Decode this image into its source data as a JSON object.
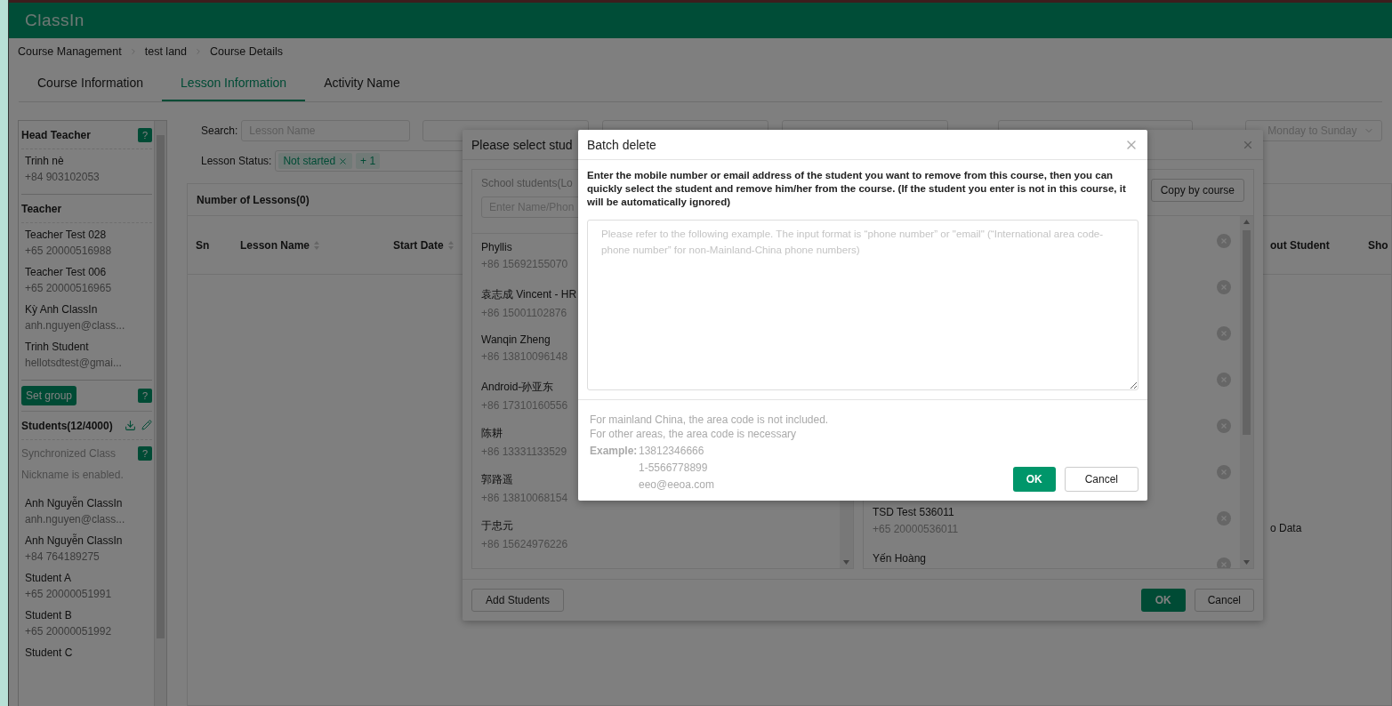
{
  "header": {
    "logo": "ClassIn"
  },
  "breadcrumb": [
    "Course Management",
    "test land",
    "Course Details"
  ],
  "tabs": [
    {
      "label": "Course Information",
      "selected": false
    },
    {
      "label": "Lesson Information",
      "selected": true
    },
    {
      "label": "Activity Name",
      "selected": false
    }
  ],
  "sidebar": {
    "head_teacher": {
      "title": "Head Teacher",
      "help": "?",
      "people": [
        {
          "name": "Trinh nè",
          "contact": "+84 903102053"
        }
      ]
    },
    "teachers": {
      "title": "Teacher",
      "people": [
        {
          "name": "Teacher Test 028",
          "contact": "+65 20000516988"
        },
        {
          "name": "Teacher Test 006",
          "contact": "+65 20000516965"
        },
        {
          "name": "Kỳ Anh ClassIn",
          "contact": "anh.nguyen@class..."
        },
        {
          "name": "Trinh Student",
          "contact": "hellotsdtest@gmai..."
        }
      ]
    },
    "set_group": {
      "label": "Set group",
      "help": "?"
    },
    "students": {
      "title": "Students(12/4000)",
      "sync_label": "Synchronized Class",
      "help": "?",
      "note": "Nickname is enabled.",
      "people": [
        {
          "name": "Anh Nguyễn ClassIn",
          "contact": "anh.nguyen@class..."
        },
        {
          "name": "Anh Nguyễn ClassIn",
          "contact": "+84 764189275"
        },
        {
          "name": "Student A",
          "contact": "+65 20000051991"
        },
        {
          "name": "Student B",
          "contact": "+65 20000051992"
        },
        {
          "name": "Student C"
        }
      ]
    }
  },
  "filters": {
    "search_label": "Search:",
    "search_placeholder": "Lesson Name",
    "week": "Monday to Sunday",
    "status_label": "Lesson Status:",
    "status_tags": [
      {
        "label": "Not started",
        "removable": true
      },
      {
        "label": "+ 1",
        "removable": false
      }
    ]
  },
  "lessons": {
    "title": "Number of Lessons(0)",
    "columns": [
      {
        "label": "Sn"
      },
      {
        "label": "Lesson Name",
        "sortable": true
      },
      {
        "label": "Start Date",
        "sortable": true
      },
      {
        "label": "out Student"
      },
      {
        "label": "Sho"
      }
    ],
    "empty": "o Data"
  },
  "select_dialog": {
    "title": "Please select stud",
    "school_label": "School students(Lo",
    "search_placeholder": "Enter Name/Phon",
    "school_students": [
      {
        "name": "Phyllis",
        "phone": "+86 15692155070"
      },
      {
        "name": "袁志成 Vincent - HR",
        "phone": "+86 15001102876"
      },
      {
        "name": "Wanqin Zheng",
        "phone": "+86 13810096148"
      },
      {
        "name": "Android-孙亚东",
        "phone": "+86 17310160556"
      },
      {
        "name": "陈耕",
        "phone": "+86 13331133529"
      },
      {
        "name": "郭路遥",
        "phone": "+86 13810068154"
      },
      {
        "name": "于忠元",
        "phone": "+86 15624976226"
      }
    ],
    "copy_button": "Copy by course",
    "selected_students": [
      {
        "kind": "covered"
      },
      {
        "kind": "covered"
      },
      {
        "kind": "covered"
      },
      {
        "kind": "covered"
      },
      {
        "kind": "covered"
      },
      {
        "kind": "covered"
      },
      {
        "kind": "student",
        "name": "TSD Test 536011",
        "phone": "+65 20000536011"
      },
      {
        "kind": "student",
        "name": "Yến Hoàng"
      }
    ],
    "add_button": "Add Students",
    "ok": "OK",
    "cancel": "Cancel"
  },
  "batch_dialog": {
    "title": "Batch delete",
    "description": "Enter the mobile number or email address of the student you want to remove from this course, then you can quickly select the student and remove him/her from the course. (If the student you enter is not in this course, it will be automatically ignored)",
    "placeholder": "Please refer to the following example. The input format is “phone number” or \"email\" (“International area code-phone number” for non-Mainland-China phone numbers)",
    "notes": [
      "For mainland China, the area code is not included.",
      "For other areas, the area code is necessary"
    ],
    "example_label": "Example:",
    "examples": [
      "13812346666",
      "1-5566778899",
      "eeo@eeoa.com"
    ],
    "ok": "OK",
    "cancel": "Cancel"
  }
}
